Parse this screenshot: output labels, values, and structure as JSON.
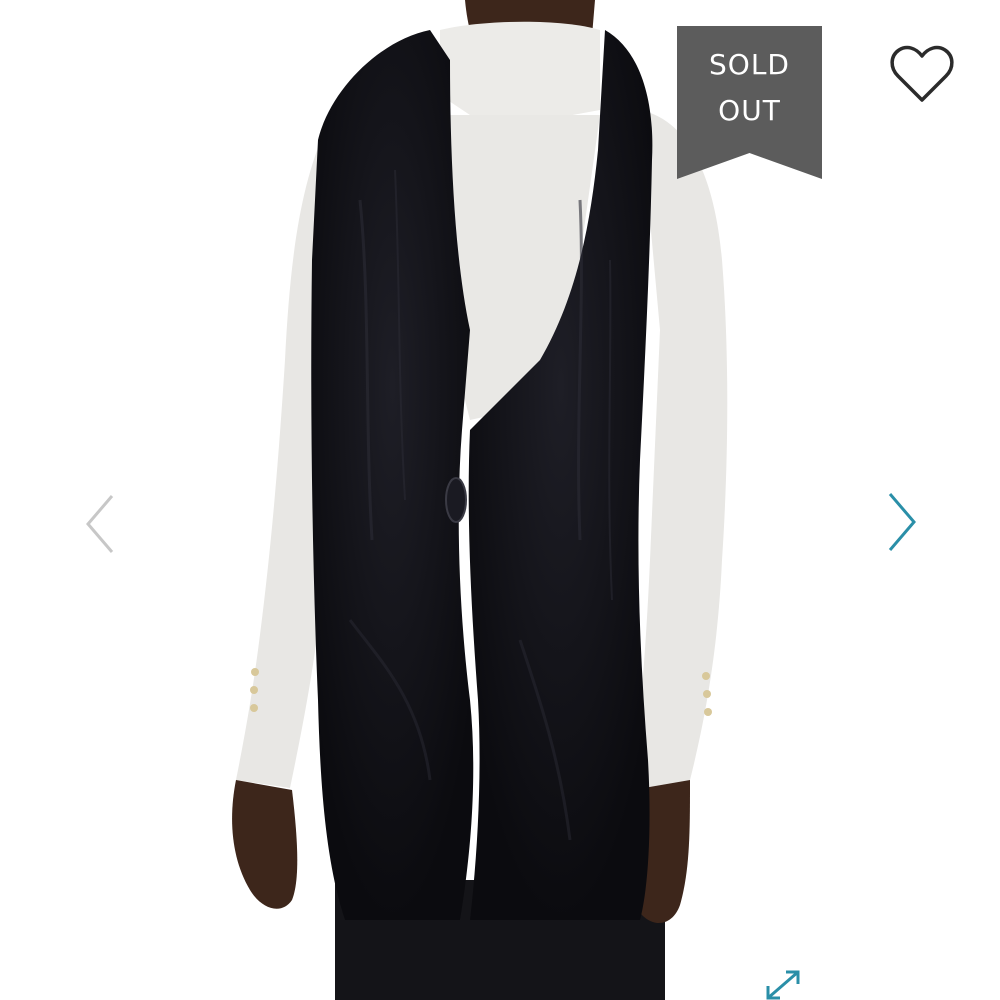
{
  "listing": {
    "badge": {
      "line1": "SOLD",
      "line2": "OUT",
      "color": "#5c5c5c"
    },
    "like_icon": "heart-outline-icon",
    "prev_icon": "chevron-left-icon",
    "next_icon": "chevron-right-icon",
    "expand_icon": "expand-arrows-icon",
    "accent_color": "#2a8fa8"
  }
}
